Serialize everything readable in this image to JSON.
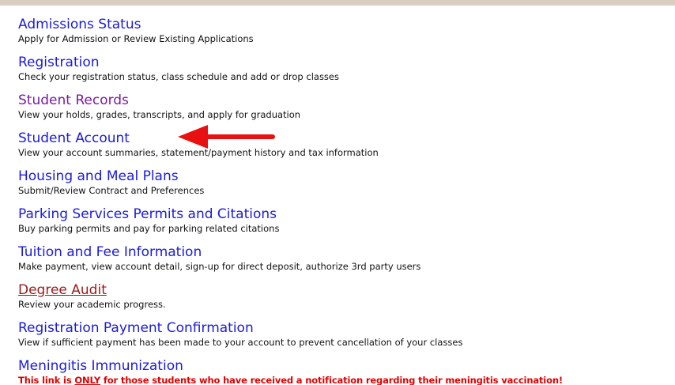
{
  "menu": {
    "items": [
      {
        "label": "Admissions Status",
        "description": "Apply for Admission or Review Existing Applications"
      },
      {
        "label": "Registration",
        "description": "Check your registration status, class schedule and add or drop classes"
      },
      {
        "label": "Student Records",
        "description": "View your holds, grades, transcripts, and apply for graduation"
      },
      {
        "label": "Student Account",
        "description": "View your account summaries, statement/payment history and tax information"
      },
      {
        "label": "Housing and Meal Plans",
        "description": "Submit/Review Contract and Preferences"
      },
      {
        "label": "Parking Services Permits and Citations",
        "description": "Buy parking permits and pay for parking related citations"
      },
      {
        "label": "Tuition and Fee Information",
        "description": "Make payment, view account detail, sign-up for direct deposit, authorize 3rd party users"
      },
      {
        "label": "Degree Audit",
        "description": "Review your academic progress."
      },
      {
        "label": "Registration Payment Confirmation",
        "description": "View if sufficient payment has been made to your account to prevent cancellation of your classes"
      },
      {
        "label": "Meningitis Immunization",
        "warning": {
          "before": "This link is ",
          "emphasis": "ONLY",
          "after": " for those students who have received a notification regarding their meningitis vaccination!"
        }
      }
    ]
  },
  "colors": {
    "link": "#1a1ae0",
    "visited_link": "#7a1aa0",
    "active_link": "#9a1a1a",
    "warning": "#e00000",
    "annotation_arrow": "#e81010",
    "top_bar": "#d9cfbf"
  },
  "annotation": {
    "icon": "red-arrow-icon",
    "points_to": "Student Account"
  }
}
